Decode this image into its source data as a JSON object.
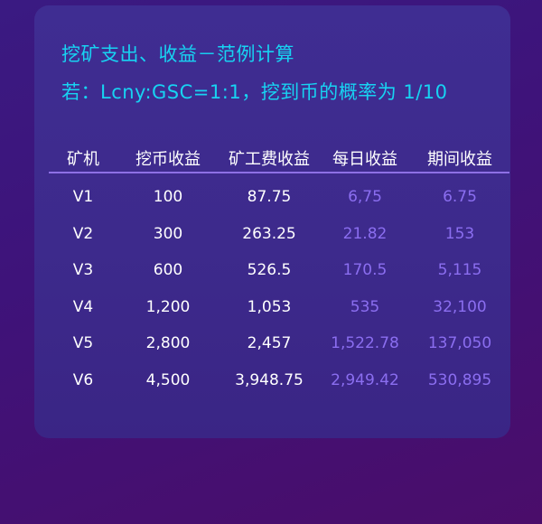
{
  "title": "挖矿支出、收益－范例计算",
  "subtitle": "若：Lcny:GSC=1:1，挖到币的概率为 1/10",
  "table": {
    "headers": [
      "矿机",
      "挖币收益",
      "矿工费收益",
      "每日收益",
      "期间收益"
    ],
    "rows": [
      [
        "V1",
        "100",
        "87.75",
        "6,75",
        "6.75"
      ],
      [
        "V2",
        "300",
        "263.25",
        "21.82",
        "153"
      ],
      [
        "V3",
        "600",
        "526.5",
        "170.5",
        "5,115"
      ],
      [
        "V4",
        "1,200",
        "1,053",
        "535",
        "32,100"
      ],
      [
        "V5",
        "2,800",
        "2,457",
        "1,522.78",
        "137,050"
      ],
      [
        "V6",
        "4,500",
        "3,948.75",
        "2,949.42",
        "530,895"
      ]
    ]
  },
  "colors": {
    "accent_cyan": "#17d3f2",
    "value_purple": "#8b6ef0",
    "divider": "#8e70e6",
    "card_bg": "#3f2d92",
    "page_bg": "#3e137a"
  }
}
